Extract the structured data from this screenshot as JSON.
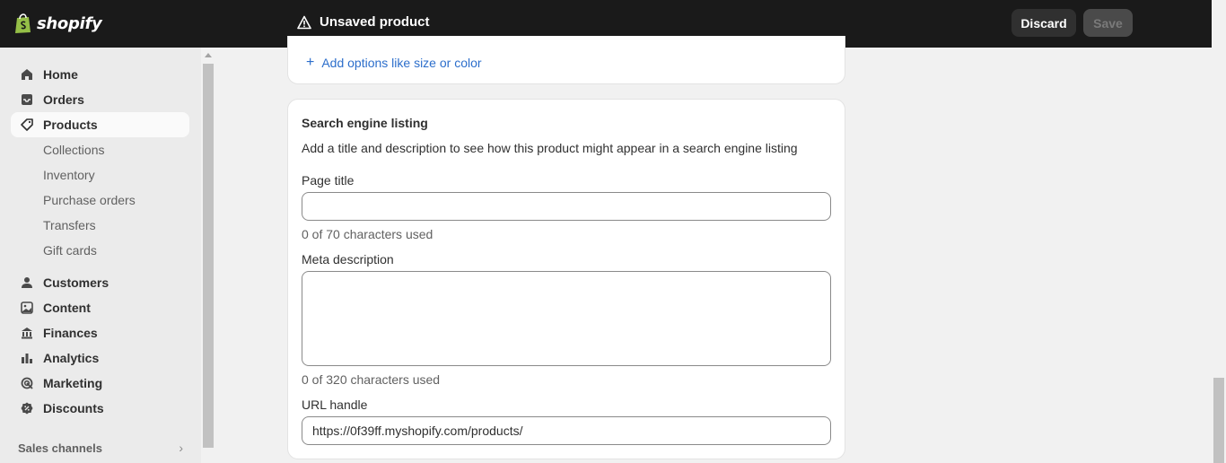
{
  "topbar": {
    "brand": "shopify",
    "status": "Unsaved product",
    "discard_label": "Discard",
    "save_label": "Save"
  },
  "sidebar": {
    "items": [
      {
        "label": "Home",
        "icon": "home-icon"
      },
      {
        "label": "Orders",
        "icon": "inbox-icon"
      },
      {
        "label": "Products",
        "icon": "tag-icon",
        "active": true
      },
      {
        "label": "Customers",
        "icon": "person-icon"
      },
      {
        "label": "Content",
        "icon": "image-icon"
      },
      {
        "label": "Finances",
        "icon": "bank-icon"
      },
      {
        "label": "Analytics",
        "icon": "bar-chart-icon"
      },
      {
        "label": "Marketing",
        "icon": "target-icon"
      },
      {
        "label": "Discounts",
        "icon": "discount-icon"
      }
    ],
    "products_sub": [
      "Collections",
      "Inventory",
      "Purchase orders",
      "Transfers",
      "Gift cards"
    ],
    "sales_channels_label": "Sales channels"
  },
  "variants_card": {
    "add_options_label": "Add options like size or color"
  },
  "seo": {
    "title": "Search engine listing",
    "description": "Add a title and description to see how this product might appear in a search engine listing",
    "page_title_label": "Page title",
    "page_title_value": "",
    "page_title_help": "0 of 70 characters used",
    "meta_label": "Meta description",
    "meta_value": "",
    "meta_help": "0 of 320 characters used",
    "url_label": "URL handle",
    "url_value": "https://0f39ff.myshopify.com/products/"
  },
  "colors": {
    "topbar": "#1a1a1a",
    "link": "#2c6ecb",
    "background": "#f1f1f1"
  }
}
